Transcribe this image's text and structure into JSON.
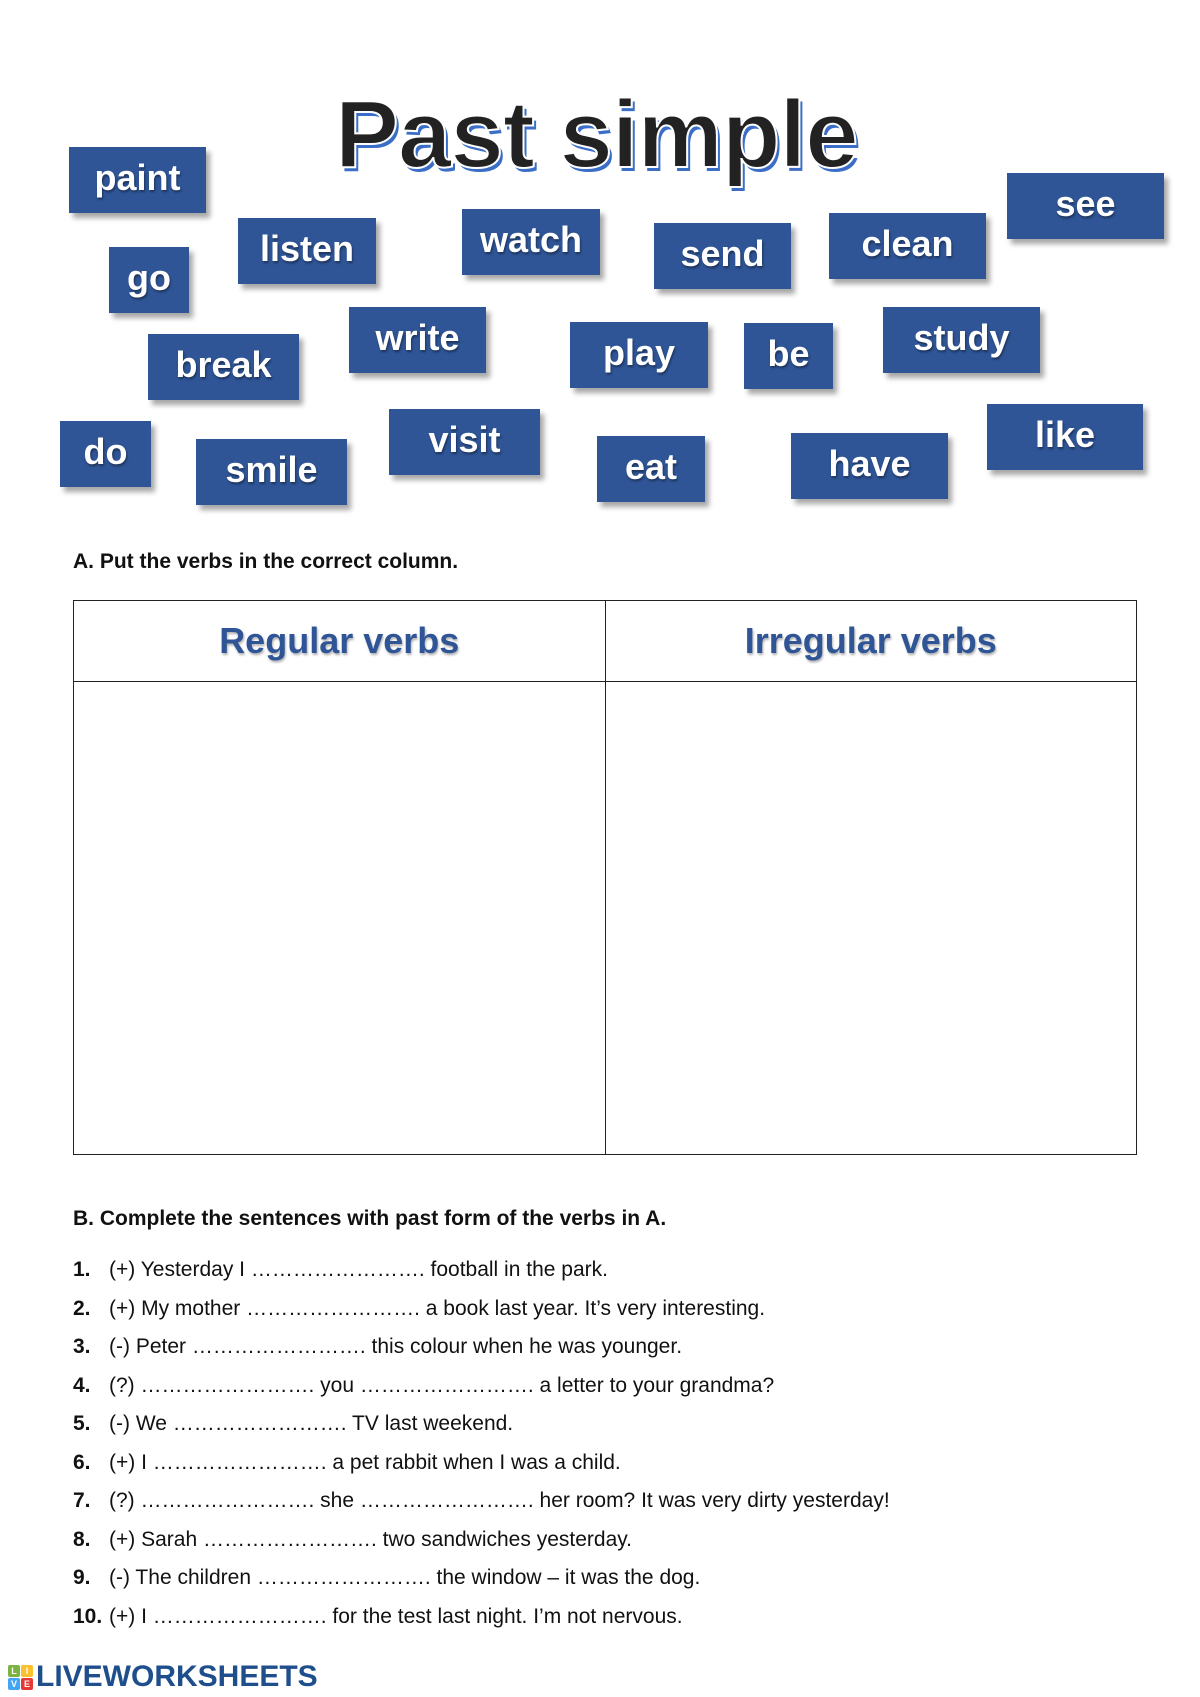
{
  "title": "Past simple",
  "verbs": [
    "paint",
    "go",
    "listen",
    "break",
    "write",
    "watch",
    "send",
    "play",
    "be",
    "clean",
    "study",
    "see",
    "do",
    "smile",
    "visit",
    "eat",
    "have",
    "like"
  ],
  "section_a": {
    "heading": "A. Put the verbs in the correct column.",
    "columns": [
      "Regular verbs",
      "Irregular verbs"
    ]
  },
  "section_b": {
    "heading": "B. Complete the sentences with past form of the verbs in A.",
    "sentences": [
      {
        "num": "1.",
        "text": "(+) Yesterday I ……………………. football in the park."
      },
      {
        "num": "2.",
        "text": "(+) My mother ……………………. a book last year. It’s very interesting."
      },
      {
        "num": "3.",
        "text": "(-) Peter ……………………. this colour when he was younger."
      },
      {
        "num": "4.",
        "text": "(?) ……………………. you ……………………. a letter to your grandma?"
      },
      {
        "num": "5.",
        "text": "(-) We ……………………. TV last weekend."
      },
      {
        "num": "6.",
        "text": "(+) I ……………………. a pet rabbit when I was a child."
      },
      {
        "num": "7.",
        "text": "(?) ……………………. she ……………………. her room? It was very dirty yesterday!"
      },
      {
        "num": "8.",
        "text": "(+) Sarah ……………………. two sandwiches yesterday."
      },
      {
        "num": "9.",
        "text": "(-) The children ……………………. the window – it was the dog."
      },
      {
        "num": "10.",
        "text": "(+) I ……………………. for the test last night. I’m not nervous."
      }
    ]
  },
  "footer": {
    "logo_blocks": [
      "L",
      "I",
      "V",
      "E"
    ],
    "logo_text": "LIVEWORKSHEETS"
  }
}
